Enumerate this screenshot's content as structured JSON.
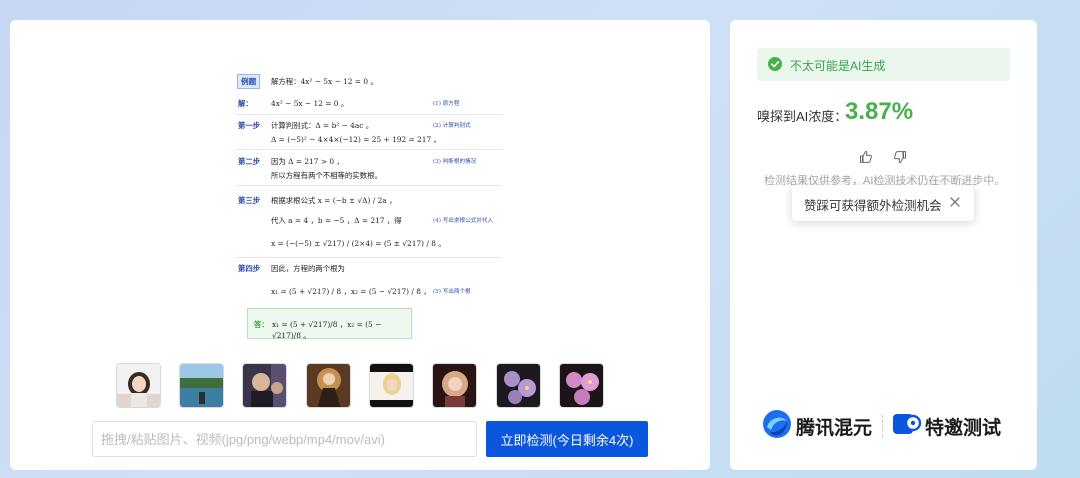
{
  "preview": {
    "badge": "例题",
    "problem": "解方程：4x² − 5x − 12 = 0 。",
    "solve_label": "解：",
    "solve_eq": "4x² − 5x − 12 = 0 。",
    "solve_note": "(1) 原方程",
    "step1_label": "第一步",
    "step1_line1": "计算判别式：Δ = b² − 4ac 。",
    "step1_line2": "Δ = (−5)² − 4×4×(−12) = 25 + 192 = 217 。",
    "step1_note": "(2) 计算判别式",
    "step2_label": "第二步",
    "step2_line1": "因为 Δ = 217 > 0 ，",
    "step2_line2": "所以方程有两个不相等的实数根。",
    "step2_note": "(3) 判断根的情况",
    "step3_label": "第三步",
    "step3_line1": "根据求根公式 x = (−b ± √Δ) / 2a ，",
    "step3_line2": "代入 a = 4 ，b = −5 ，Δ = 217 ，得",
    "step3_line3": "x = (−(−5) ± √217) / (2×4) = (5 ± √217) / 8 。",
    "step3_note": "(4) 写出求根公式并代入",
    "step4_label": "第四步",
    "step4_line1": "因此，方程的两个根为",
    "step4_line2": "x₁ = (5 + √217) / 8 ，x₂ = (5 − √217) / 8 ，",
    "step4_note": "(5) 写出两个根",
    "answer_label": "答：",
    "answer_body": "x₁ = (5 + √217)/8 ，x₂ = (5 − √217)/8 。"
  },
  "upload": {
    "placeholder": "拖拽/粘贴图片、视频(jpg/png/webp/mp4/mov/avi)",
    "button": "立即检测(今日剩余4次)"
  },
  "result": {
    "verdict": "不太可能是AI生成",
    "concentration_label": "嗅探到AI浓度：",
    "concentration_value": "3.87%",
    "disclaimer": "检测结果仅供参考，AI检测技术仍在不断进步中。",
    "tooltip": "赞踩可获得额外检测机会"
  },
  "brand": {
    "logo1_name": "腾讯混元",
    "logo2_name": "特邀测试"
  },
  "colors": {
    "accent_blue": "#0a56dd",
    "success_green": "#4ab04f",
    "verdict_bg": "#ebf7ec"
  },
  "icons": {
    "verdict": "check-circle-icon",
    "like": "thumbs-up-icon",
    "dislike": "thumbs-down-icon",
    "close": "close-icon"
  }
}
